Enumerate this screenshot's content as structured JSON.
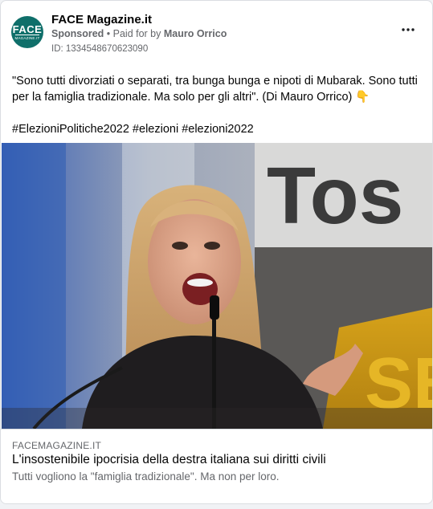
{
  "header": {
    "avatar_big": "FACE",
    "avatar_small": "MAGAZINE.IT",
    "page_name": "FACE Magazine.it",
    "sponsored": "Sponsored",
    "separator": " • ",
    "paid_for_prefix": "Paid for by ",
    "paid_for_name": "Mauro Orrico",
    "ad_id": "ID: 1334548670623090",
    "more_icon": "•••"
  },
  "post": {
    "text": "\"Sono tutti divorziati o separati, tra bunga bunga e nipoti di Mubarak. Sono tutti per la famiglia tradizionale. Ma solo per gli altri\". (Di Mauro Orrico) ",
    "emoji": "👇",
    "hashtags": "#ElezioniPolitiche2022 #elezioni #elezioni2022"
  },
  "image": {
    "sign_text": "Tos",
    "sign_text_lower": "SE"
  },
  "link": {
    "domain": "FACEMAGAZINE.IT",
    "title": "L'insostenibile ipocrisia della destra italiana sui diritti civili",
    "description": "Tutti vogliono la \"famiglia tradizionale\". Ma non per loro."
  }
}
